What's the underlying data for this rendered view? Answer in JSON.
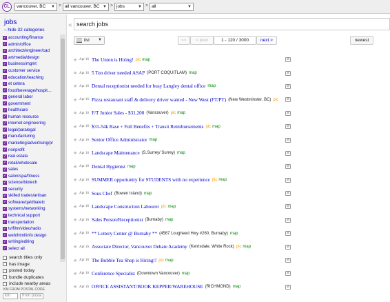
{
  "topbar": {
    "logo": "CL",
    "crumbs": [
      "vancouver, BC",
      "all vancouver, BC",
      "jobs",
      "all"
    ]
  },
  "sidebar": {
    "title": "jobs",
    "hide_link": "– hide 32 categories",
    "categories": [
      "accounting/finance",
      "admin/office",
      "architect/engineer/cad",
      "art/media/design",
      "business/mgmt",
      "customer service",
      "education/teaching",
      "et cetera",
      "food/beverage/hospit…",
      "general labor",
      "government",
      "healthcare",
      "human resource",
      "internet engineering",
      "legal/paralegal",
      "manufacturing",
      "marketing/advertising/pr",
      "nonprofit",
      "real estate",
      "retail/wholesale",
      "sales",
      "salon/spa/fitness",
      "science/biotech",
      "security",
      "skilled trades/artisan",
      "software/qa/dba/etc",
      "systems/networking",
      "technical support",
      "transportation",
      "tv/film/video/radio",
      "web/html/info design",
      "writing/editing",
      "select all"
    ],
    "options": [
      "search titles only",
      "has image",
      "posted today",
      "bundle duplicates",
      "include nearby areas"
    ],
    "km_label": "KM FROM POSTAL CODE",
    "km_placeholder": "km",
    "postal_placeholder": "from posta"
  },
  "main": {
    "collapse_icon": "«",
    "search_value": "search jobs",
    "view_label": "list",
    "pager": {
      "first": "<<",
      "prev": "< prev",
      "range": "1 - 120 / 3000",
      "next": "next >"
    },
    "sort": "newest",
    "results": [
      {
        "date": "Apr 16",
        "title": "The Union is Hiring!",
        "loc": "",
        "pic": "pic",
        "map": "map"
      },
      {
        "date": "Apr 16",
        "title": "5 Ton driver needed ASAP",
        "loc": "(PORT COQUITLAM)",
        "pic": "",
        "map": "map"
      },
      {
        "date": "Apr 16",
        "title": "Dental receptionist needed for busy Langley dental office",
        "loc": "",
        "pic": "",
        "map": "map"
      },
      {
        "date": "Apr 16",
        "title": "Pizza restaurant staff & delivery driver wanted - New West (FT/PT)",
        "loc": "(New Westminster, BC)",
        "pic": "pic",
        "map": ""
      },
      {
        "date": "Apr 16",
        "title": "F/T Junior Sales - $31,200",
        "loc": "(Vancouver)",
        "pic": "pic",
        "map": "map"
      },
      {
        "date": "Apr 16",
        "title": "$31-54k Base + Full Benefits + Transit Reimbursements",
        "loc": "",
        "pic": "pic",
        "map": "map"
      },
      {
        "date": "Apr 16",
        "title": "Senior Office Administrator",
        "loc": "",
        "pic": "",
        "map": "map"
      },
      {
        "date": "Apr 16",
        "title": "Landscape Maintenance",
        "loc": "(S.Surrey/ Surrey)",
        "pic": "",
        "map": "map"
      },
      {
        "date": "Apr 16",
        "title": "Dental Hygienist",
        "loc": "",
        "pic": "",
        "map": "map"
      },
      {
        "date": "Apr 16",
        "title": "SUMMER opportunity for STUDENTS with no experience",
        "loc": "",
        "pic": "pic",
        "map": "map"
      },
      {
        "date": "Apr 16",
        "title": "Sous Chef",
        "loc": "(Bowen Island)",
        "pic": "",
        "map": "map"
      },
      {
        "date": "Apr 16",
        "title": "Landscape Construction Labourer",
        "loc": "",
        "pic": "pic",
        "map": "map"
      },
      {
        "date": "Apr 16",
        "title": "Sales Person/Receptionist",
        "loc": "(Burnaby)",
        "pic": "",
        "map": "map"
      },
      {
        "date": "Apr 16",
        "title": "** Lottery Center @ Burnaby **",
        "loc": "(4567 Lougheed Hwy #260, Burnaby)",
        "pic": "",
        "map": "map"
      },
      {
        "date": "Apr 16",
        "title": "Associate Director, Vancouver Debate Academy",
        "loc": "(Kerrisdale, White Rock)",
        "pic": "pic",
        "map": "map"
      },
      {
        "date": "Apr 16",
        "title": "The Bubble Tea Shop is Hiring!!",
        "loc": "",
        "pic": "pic",
        "map": "map"
      },
      {
        "date": "Apr 16",
        "title": "Conference Specialist",
        "loc": "(Downtown Vancouver)",
        "pic": "",
        "map": "map"
      },
      {
        "date": "Apr 16",
        "title": "OFFICE ASSISTANT/BOOK KEPPER/WAREHOUSE",
        "loc": "(RICHMOND)",
        "pic": "",
        "map": "map"
      }
    ]
  }
}
